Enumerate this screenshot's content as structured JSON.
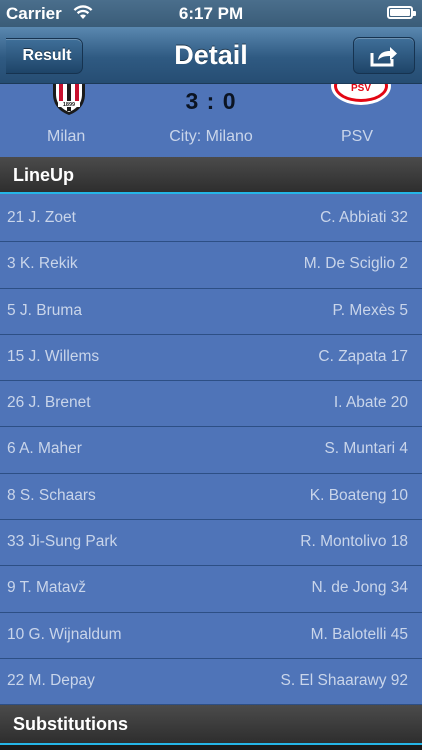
{
  "status_bar": {
    "carrier": "Carrier",
    "time": "6:17 PM",
    "wifi_icon": "wifi-icon",
    "battery_icon": "battery-icon"
  },
  "nav": {
    "back_label": "Result",
    "title": "Detail",
    "share_icon": "share-icon"
  },
  "match": {
    "home_team": "Milan",
    "away_team": "PSV",
    "city": "City: Milano",
    "score": "3 : 0",
    "home_logo_text": "1899",
    "away_logo_text": "PSV"
  },
  "sections": {
    "lineup": "LineUp",
    "substitutions": "Substitutions"
  },
  "lineup": [
    {
      "home": "21 J. Zoet",
      "away": "C. Abbiati 32"
    },
    {
      "home": "3 K. Rekik",
      "away": "M. De Sciglio 2"
    },
    {
      "home": "5 J. Bruma",
      "away": "P. Mexès 5"
    },
    {
      "home": "15 J. Willems",
      "away": "C. Zapata 17"
    },
    {
      "home": "26 J. Brenet",
      "away": "I. Abate 20"
    },
    {
      "home": "6 A. Maher",
      "away": "S. Muntari 4"
    },
    {
      "home": "8 S. Schaars",
      "away": "K. Boateng 10"
    },
    {
      "home": "33 Ji-Sung Park",
      "away": "R. Montolivo 18"
    },
    {
      "home": "9 T. Matavž",
      "away": "N. de Jong 34"
    },
    {
      "home": "10 G. Wijnaldum",
      "away": "M. Balotelli 45"
    },
    {
      "home": "22 M. Depay",
      "away": "S. El Shaarawy 92"
    }
  ],
  "colors": {
    "background": "#4f74b8",
    "accent": "#25b5e6",
    "header_dark": "#2e2e2e"
  }
}
